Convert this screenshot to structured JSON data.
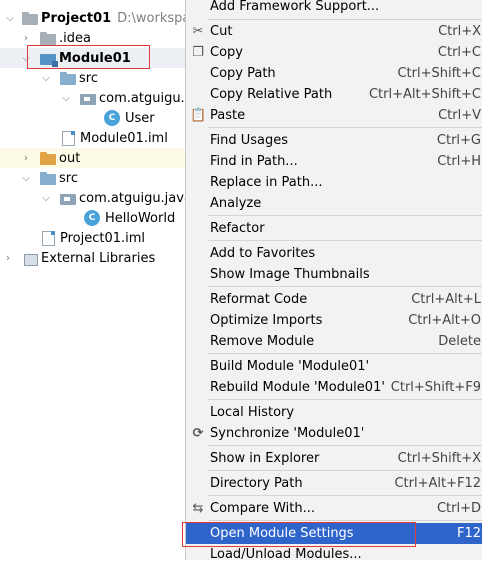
{
  "tree": {
    "project": {
      "label": "Project01",
      "path": "D:\\workspace"
    },
    "idea": {
      "label": ".idea"
    },
    "module": {
      "label": "Module01"
    },
    "module_src": {
      "label": "src"
    },
    "module_package": {
      "label": "com.atguigu.bean"
    },
    "user_class": {
      "label": "User"
    },
    "module_iml": {
      "label": "Module01.iml"
    },
    "out": {
      "label": "out"
    },
    "src": {
      "label": "src"
    },
    "java_package": {
      "label": "com.atguigu.java"
    },
    "helloworld": {
      "label": "HelloWorld"
    },
    "project_iml": {
      "label": "Project01.iml"
    },
    "external_libraries": {
      "label": "External Libraries"
    }
  },
  "menu": {
    "add_framework": {
      "label": "Add Framework Support..."
    },
    "cut": {
      "label": "Cut",
      "shortcut": "Ctrl+X"
    },
    "copy": {
      "label": "Copy",
      "shortcut": "Ctrl+C"
    },
    "copy_path": {
      "label": "Copy Path",
      "shortcut": "Ctrl+Shift+C"
    },
    "copy_relative_path": {
      "label": "Copy Relative Path",
      "shortcut": "Ctrl+Alt+Shift+C"
    },
    "paste": {
      "label": "Paste",
      "shortcut": "Ctrl+V"
    },
    "find_usages": {
      "label": "Find Usages",
      "shortcut": "Ctrl+G"
    },
    "find_in_path": {
      "label": "Find in Path...",
      "shortcut": "Ctrl+H"
    },
    "replace_in_path": {
      "label": "Replace in Path..."
    },
    "analyze": {
      "label": "Analyze"
    },
    "refactor": {
      "label": "Refactor"
    },
    "add_to_favorites": {
      "label": "Add to Favorites"
    },
    "show_thumbnails": {
      "label": "Show Image Thumbnails"
    },
    "reformat_code": {
      "label": "Reformat Code",
      "shortcut": "Ctrl+Alt+L"
    },
    "optimize_imports": {
      "label": "Optimize Imports",
      "shortcut": "Ctrl+Alt+O"
    },
    "remove_module": {
      "label": "Remove Module",
      "shortcut": "Delete"
    },
    "build_module": {
      "label": "Build Module 'Module01'"
    },
    "rebuild_module": {
      "label": "Rebuild Module 'Module01'",
      "shortcut": "Ctrl+Shift+F9"
    },
    "local_history": {
      "label": "Local History"
    },
    "synchronize": {
      "label": "Synchronize 'Module01'"
    },
    "show_in_explorer": {
      "label": "Show in Explorer",
      "shortcut": "Ctrl+Shift+X"
    },
    "directory_path": {
      "label": "Directory Path",
      "shortcut": "Ctrl+Alt+F12"
    },
    "compare_with": {
      "label": "Compare With...",
      "shortcut": "Ctrl+D"
    },
    "open_module_settings": {
      "label": "Open Module Settings",
      "shortcut": "F12"
    },
    "load_unload_modules": {
      "label": "Load/Unload Modules..."
    }
  },
  "colors": {
    "selection": "#2f65ca",
    "annotation": "#e03a3a",
    "menu_bg": "#f2f2f2"
  }
}
